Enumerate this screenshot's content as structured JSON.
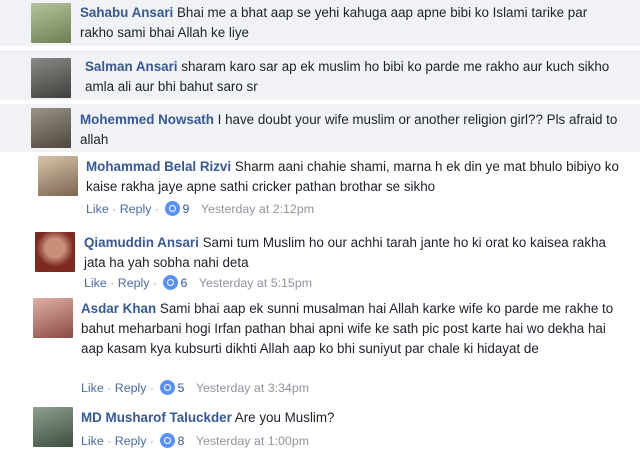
{
  "comments": [
    {
      "name": "Sahabu Ansari",
      "text": "Bhai me a bhat aap se yehi kahuga aap apne bibi ko Islami tarike par rakho sami bhai Allah ke liye",
      "avatar_color": "#8a9a6e"
    },
    {
      "name": "Salman Ansari",
      "text": "sharam karo sar ap ek muslim ho bibi ko parde me rakho aur kuch sikho amla ali aur bhi bahut saro sr",
      "avatar_color": "#5a5a58"
    },
    {
      "name": "Mohemmed Nowsath",
      "text": "I have doubt your wife muslim or another religion girl?? Pls afraid to allah",
      "avatar_color": "#6f6a60"
    },
    {
      "name": "Mohammad Belal Rizvi",
      "text": "Sharm aani chahie shami, marna h ek din ye mat bhulo bibiyo ko kaise rakha jaye apne sathi cricker pathan brothar se sikho",
      "avatar_color": "#a89078",
      "like": "Like",
      "reply": "Reply",
      "reactions": "9",
      "time": "Yesterday at 2:12pm"
    },
    {
      "name": "Qiamuddin Ansari",
      "text": "Sami tum Muslim ho our achhi tarah jante ho ki orat ko kaisea rakha jata ha yah sobha nahi deta",
      "avatar_color": "#9a5a48",
      "like": "Like",
      "reply": "Reply",
      "reactions": "6",
      "time": "Yesterday at 5:15pm"
    },
    {
      "name": "Asdar Khan",
      "text": "Sami bhai aap ek sunni musalman hai Allah karke wife ko parde me rakhe to bahut meharbani hogi Irfan pathan bhai apni wife ke sath pic post karte hai wo dekha hai aap kasam kya kubsurti dikhti Allah aap ko bhi suniyut par chale ki hidayat de",
      "avatar_color": "#c08a80",
      "like": "Like",
      "reply": "Reply",
      "reactions": "5",
      "time": "Yesterday at 3:34pm"
    },
    {
      "name": "MD Musharof Taluckder",
      "text": "Are you Muslim?",
      "avatar_color": "#6a7a6e",
      "like": "Like",
      "reply": "Reply",
      "reactions": "8",
      "time": "Yesterday at 1:00pm"
    }
  ],
  "colors": {
    "name_link": "#365899",
    "comment_text": "#1d2129",
    "meta_text": "#90949c",
    "reaction_blue": "#5890ff",
    "row_shade": "#f0f2f6"
  },
  "icons": [
    "user-avatar",
    "like-reaction-icon"
  ]
}
